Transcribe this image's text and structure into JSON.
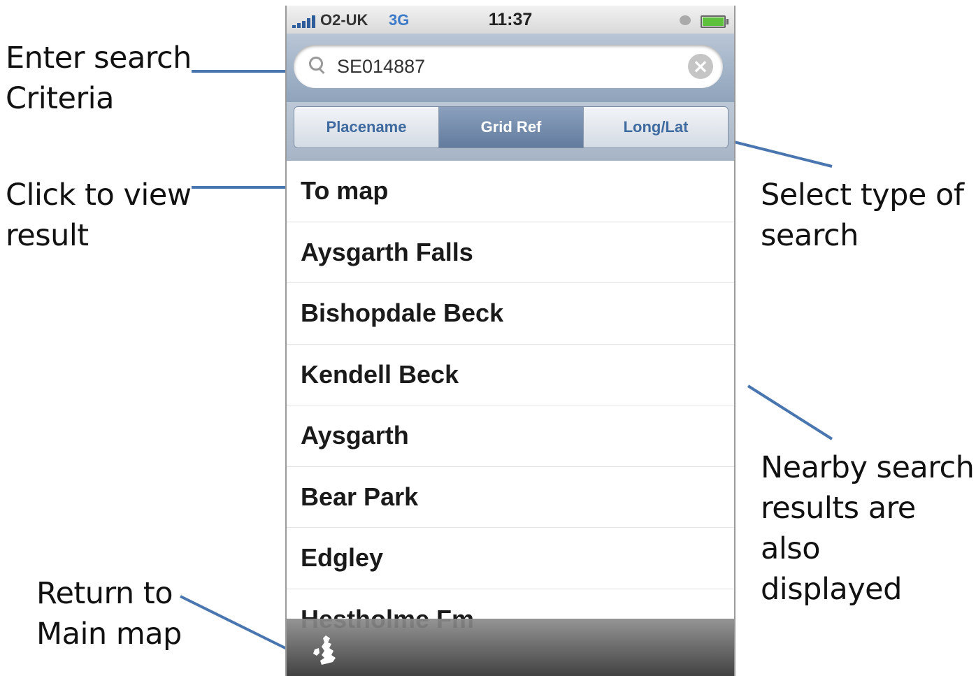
{
  "annotations": {
    "enter_search": "Enter search\nCriteria",
    "click_result": "Click to view\nresult",
    "return_map": "Return to\nMain map",
    "select_type": "Select type of\nsearch",
    "nearby": "Nearby search\nresults are also\ndisplayed"
  },
  "status_bar": {
    "carrier": "O2-UK",
    "network": "3G",
    "time": "11:37"
  },
  "search": {
    "value": "SE014887"
  },
  "scope_tabs": [
    {
      "label": "Placename",
      "selected": false
    },
    {
      "label": "Grid Ref",
      "selected": true
    },
    {
      "label": "Long/Lat",
      "selected": false
    }
  ],
  "results": [
    "To map",
    "Aysgarth Falls",
    "Bishopdale Beck",
    "Kendell Beck",
    "Aysgarth",
    "Bear Park",
    "Edgley",
    "Hestholme Fm"
  ],
  "colors": {
    "annotation_line": "#4a76b0",
    "active_segment": "#6a82a3",
    "segment_text": "#3e6a9f"
  },
  "icons": {
    "toolbar": "uk-map-icon"
  }
}
